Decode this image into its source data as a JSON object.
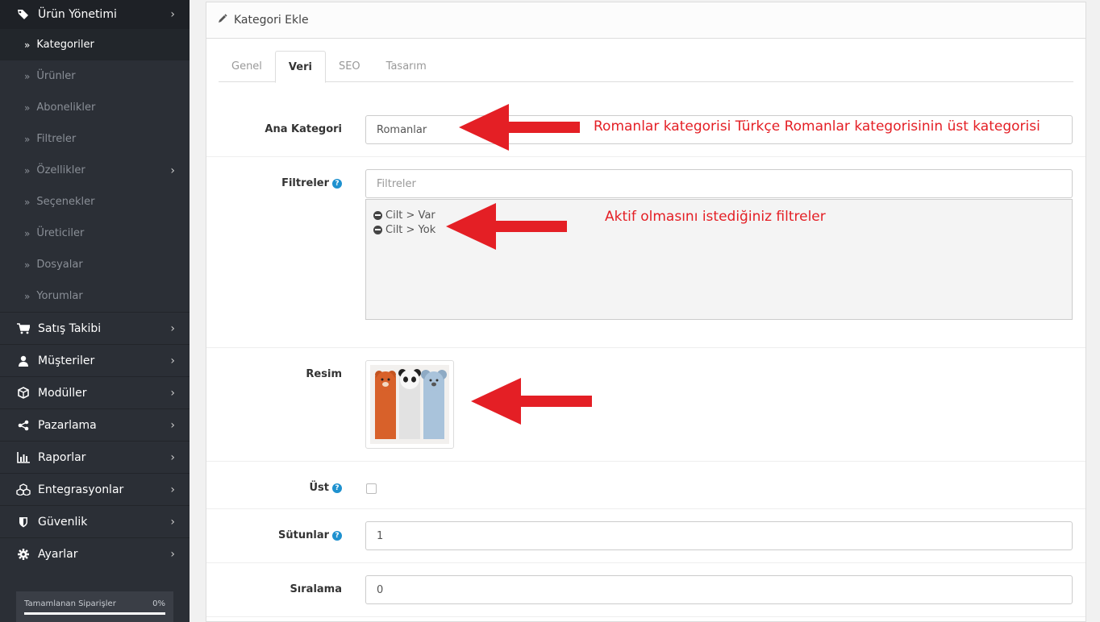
{
  "sidebar": {
    "top": {
      "label": "Ürün Yönetimi",
      "icon": "tags-icon"
    },
    "sub_items": [
      {
        "label": "Kategoriler",
        "active": true
      },
      {
        "label": "Ürünler"
      },
      {
        "label": "Abonelikler"
      },
      {
        "label": "Filtreler"
      },
      {
        "label": "Özellikler",
        "has_children": true
      },
      {
        "label": "Seçenekler"
      },
      {
        "label": "Üreticiler"
      },
      {
        "label": "Dosyalar"
      },
      {
        "label": "Yorumlar"
      }
    ],
    "items": [
      {
        "label": "Satış Takibi",
        "icon": "cart-icon"
      },
      {
        "label": "Müşteriler",
        "icon": "user-icon"
      },
      {
        "label": "Modüller",
        "icon": "cube-icon"
      },
      {
        "label": "Pazarlama",
        "icon": "share-icon"
      },
      {
        "label": "Raporlar",
        "icon": "bar-chart-icon"
      },
      {
        "label": "Entegrasyonlar",
        "icon": "cubes-icon"
      },
      {
        "label": "Güvenlik",
        "icon": "shield-icon"
      },
      {
        "label": "Ayarlar",
        "icon": "gear-icon"
      }
    ],
    "progress": {
      "label": "Tamamlanan Siparişler",
      "value_text": "0%"
    }
  },
  "panel": {
    "title": "Kategori Ekle",
    "tabs": [
      "Genel",
      "Veri",
      "SEO",
      "Tasarım"
    ],
    "active_tab": "Veri"
  },
  "form": {
    "parent_label": "Ana Kategori",
    "parent_value": "Romanlar",
    "filters_label": "Filtreler",
    "filters_placeholder": "Filtreler",
    "filter_items": [
      "Cilt > Var",
      "Cilt > Yok"
    ],
    "image_label": "Resim",
    "top_label": "Üst",
    "columns_label": "Sütunlar",
    "columns_value": "1",
    "sort_label": "Sıralama",
    "sort_value": "0"
  },
  "annotations": {
    "parent_note": "Romanlar kategorisi Türkçe Romanlar kategorisinin üst kategorisi",
    "filters_note": "Aktif olmasını istediğiniz filtreler"
  },
  "colors": {
    "sidebar_bg": "#2b2f36",
    "accent": "#1e91cf",
    "annotation_red": "#e41f25"
  }
}
